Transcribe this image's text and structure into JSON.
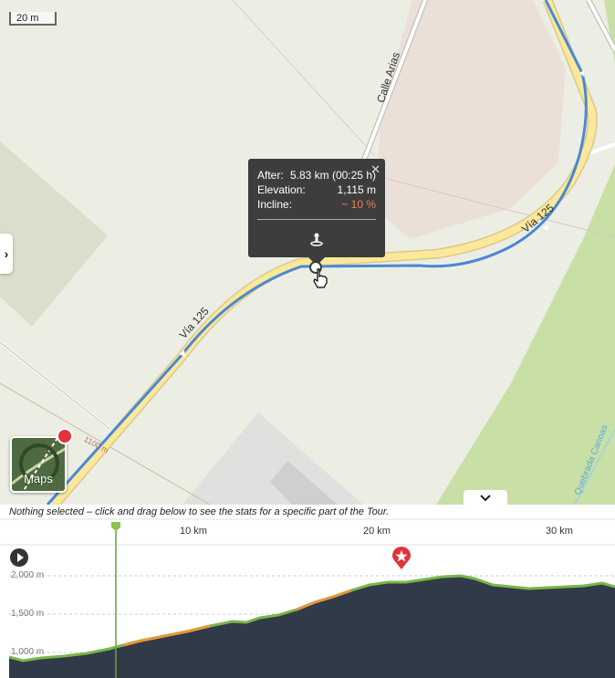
{
  "map": {
    "scale_label": "20 m",
    "street_labels": [
      "Calle Arias",
      "Vía 125",
      "Vía 125"
    ],
    "contour_label": "1100 m",
    "water_label": "Quebrada Canoas",
    "colors": {
      "route": "#4a88d6",
      "road": "#fbe89a",
      "popup": "#3d3d3d",
      "incline": "#f07f4e"
    }
  },
  "popup": {
    "after_label": "After:",
    "after_value": "5.83 km (00:25 h)",
    "elevation_label": "Elevation:",
    "elevation_value": "1,115 m",
    "incline_label": "Incline:",
    "incline_value": "~ 10 %",
    "close_icon": "close-icon",
    "action_icon": "person-pin-icon"
  },
  "controls": {
    "maps_label": "Maps",
    "side_toggle_icon": "chevron-right-icon",
    "collapse_icon": "chevron-down-icon"
  },
  "profile": {
    "hint": "Nothing selected – click and drag below to see the stats for a specific part of the Tour.",
    "km_ticks": [
      "10 km",
      "20 km",
      "30 km"
    ],
    "elevation_ticks": [
      "2,000 m",
      "1,500 m",
      "1,000 m"
    ]
  }
}
